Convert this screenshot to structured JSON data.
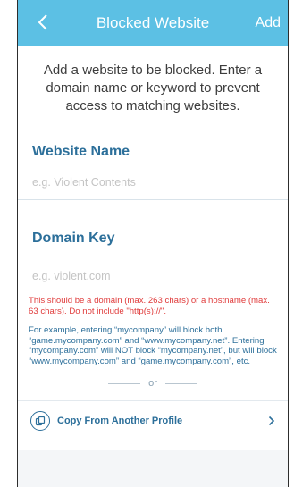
{
  "header": {
    "title": "Blocked Website",
    "add_label": "Add"
  },
  "intro": {
    "text": "Add a website to be blocked. Enter a domain name or keyword to prevent access to matching websites."
  },
  "website_name": {
    "label": "Website Name",
    "placeholder": "e.g. Violent Contents",
    "value": ""
  },
  "domain_key": {
    "label": "Domain Key",
    "placeholder": "e.g. violent.com",
    "value": ""
  },
  "help": {
    "warning": "This should be a domain (max. 263 chars) or a hostname (max. 63 chars). Do not include \"http(s)://\".",
    "example": "For example, entering “mycompany” will block both “game.mycompany.com” and “www.mycompany.net”. Entering “mycompany.com” will NOT block “mycompany.net”, but will block “www.mycompany.com” and “game.mycompany.com”, etc."
  },
  "divider": {
    "or_label": "or"
  },
  "copy_profile": {
    "label": "Copy From Another Profile"
  },
  "colors": {
    "header_bg": "#5cc0e4",
    "accent": "#2c6f9a",
    "warning": "#e03b3b"
  },
  "icons": {
    "back": "chevron-left-icon",
    "copy": "copy-icon",
    "forward": "chevron-right-icon"
  }
}
